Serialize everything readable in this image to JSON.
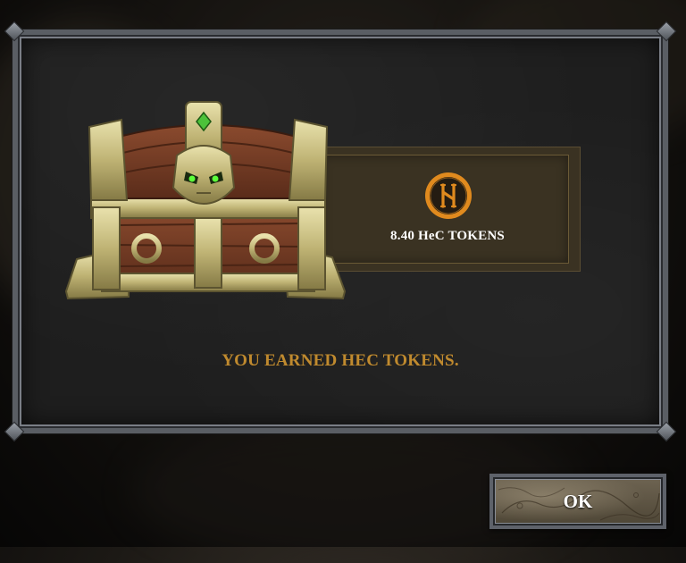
{
  "reward": {
    "token_icon": "hec-token-coin-icon",
    "amount_label": "8.40 HeC TOKENS",
    "accent_color": "#e08a1e"
  },
  "message": {
    "text": "YOU EARNED HEC TOKENS.",
    "color": "#c08a2e"
  },
  "chest": {
    "icon": "treasure-chest-icon"
  },
  "actions": {
    "ok_label": "OK"
  }
}
